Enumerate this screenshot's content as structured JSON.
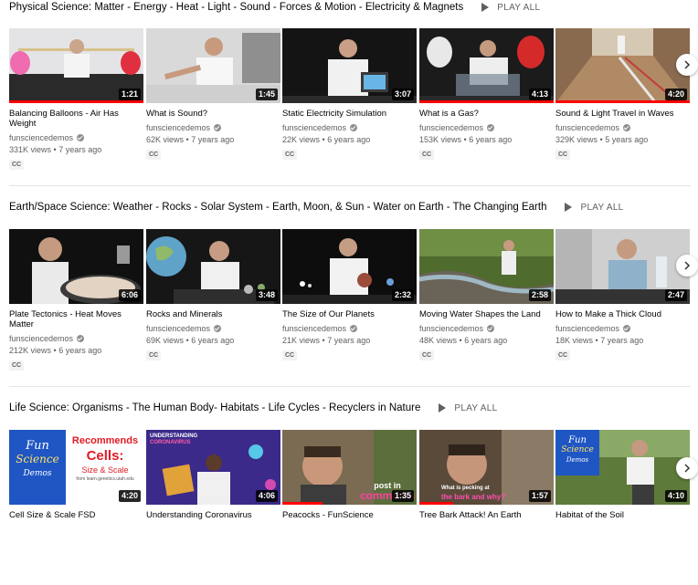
{
  "shelves": [
    {
      "title": "Physical Science: Matter - Energy - Heat - Light - Sound - Forces & Motion - Electricity & Magnets",
      "play_all": "PLAY ALL",
      "videos": [
        {
          "title": "Balancing Balloons - Air Has Weight",
          "channel": "funsciencedemos",
          "views": "331K views",
          "age": "7 years ago",
          "duration": "1:21",
          "badge": "CC",
          "progress": 1.0
        },
        {
          "title": "What is Sound?",
          "channel": "funsciencedemos",
          "views": "62K views",
          "age": "7 years ago",
          "duration": "1:45",
          "badge": "CC",
          "progress": 0
        },
        {
          "title": "Static Electricity Simulation",
          "channel": "funsciencedemos",
          "views": "22K views",
          "age": "6 years ago",
          "duration": "3:07",
          "badge": "CC",
          "progress": 0
        },
        {
          "title": "What is a Gas?",
          "channel": "funsciencedemos",
          "views": "153K views",
          "age": "6 years ago",
          "duration": "4:13",
          "badge": "CC",
          "progress": 1.0
        },
        {
          "title": "Sound & Light Travel in Waves",
          "channel": "funsciencedemos",
          "views": "329K views",
          "age": "5 years ago",
          "duration": "4:20",
          "badge": "CC",
          "progress": 1.0
        }
      ]
    },
    {
      "title": "Earth/Space Science: Weather - Rocks - Solar System - Earth, Moon, & Sun - Water on Earth - The Changing Earth",
      "play_all": "PLAY ALL",
      "videos": [
        {
          "title": "Plate Tectonics - Heat Moves Matter",
          "channel": "funsciencedemos",
          "views": "212K views",
          "age": "6 years ago",
          "duration": "6:06",
          "badge": "CC",
          "progress": 0
        },
        {
          "title": "Rocks and Minerals",
          "channel": "funsciencedemos",
          "views": "69K views",
          "age": "6 years ago",
          "duration": "3:48",
          "badge": "CC",
          "progress": 0
        },
        {
          "title": "The Size of Our Planets",
          "channel": "funsciencedemos",
          "views": "21K views",
          "age": "7 years ago",
          "duration": "2:32",
          "badge": "CC",
          "progress": 0
        },
        {
          "title": "Moving Water Shapes the Land",
          "channel": "funsciencedemos",
          "views": "48K views",
          "age": "6 years ago",
          "duration": "2:58",
          "badge": "CC",
          "progress": 0
        },
        {
          "title": "How to Make a Thick Cloud",
          "channel": "funsciencedemos",
          "views": "18K views",
          "age": "7 years ago",
          "duration": "2:47",
          "badge": "CC",
          "progress": 0
        }
      ]
    },
    {
      "title": "Life Science: Organisms - The Human Body- Habitats - Life Cycles - Recyclers in Nature",
      "play_all": "PLAY ALL",
      "videos": [
        {
          "title": "Cell Size & Scale FSD",
          "duration": "4:20",
          "progress": 0,
          "thumb_text": [
            "Recommends",
            "Cells:",
            "Size & Scale",
            "from learn.genetics.utah.edu"
          ]
        },
        {
          "title": "Understanding Coronavirus",
          "duration": "4:06",
          "progress": 0,
          "thumb_text": [
            "UNDERSTANDING",
            "CORONAVIRUS"
          ]
        },
        {
          "title": "Peacocks - FunScience",
          "duration": "1:35",
          "progress": 0.3,
          "thumb_text": [
            "post in",
            "comments"
          ]
        },
        {
          "title": "Tree Bark Attack! An Earth",
          "duration": "1:57",
          "progress": 0.25,
          "thumb_text": [
            "What is pecking at",
            "the bark and why?"
          ]
        },
        {
          "title": "Habitat of the Soil",
          "duration": "4:10",
          "progress": 0,
          "thumb_text": [
            "Fun",
            "Science",
            "Demos"
          ]
        }
      ]
    }
  ],
  "logo_text": [
    "Fun",
    "Science",
    "Demos"
  ],
  "accent_color": "#ff0000"
}
